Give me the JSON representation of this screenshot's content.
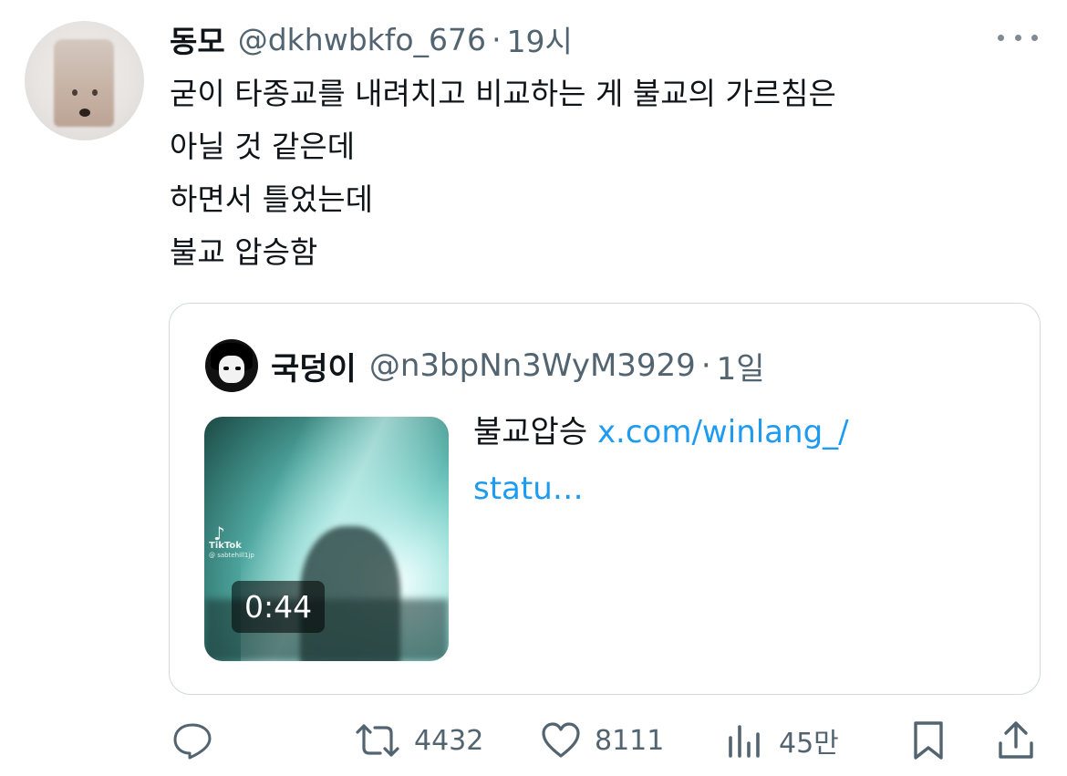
{
  "tweet": {
    "author_name": "동모",
    "author_handle": "@dkhwbkfo_676",
    "separator": "·",
    "time": "19시",
    "text_lines": [
      "굳이 타종교를 내려치고 비교하는 게 불교의 가르침은",
      "아닐 것 같은데",
      "하면서 틀었는데",
      "불교 압승함"
    ]
  },
  "quote": {
    "author_name": "국덩이",
    "author_handle": "@n3bpNn3WyM3929",
    "separator": "·",
    "time": "1일",
    "text": "불교압승",
    "link_line1": "x.com/winlang_/",
    "link_line2": "statu…",
    "media": {
      "duration": "0:44",
      "watermark_brand": "TikTok",
      "watermark_user": "@ sabtehill1jp"
    }
  },
  "actions": {
    "reply_count": "",
    "retweet_count": "4432",
    "like_count": "8111",
    "views_count": "45만"
  },
  "colors": {
    "text_primary": "#0f1419",
    "text_secondary": "#536471",
    "link": "#1d9bf0",
    "border": "#cfd9de"
  }
}
